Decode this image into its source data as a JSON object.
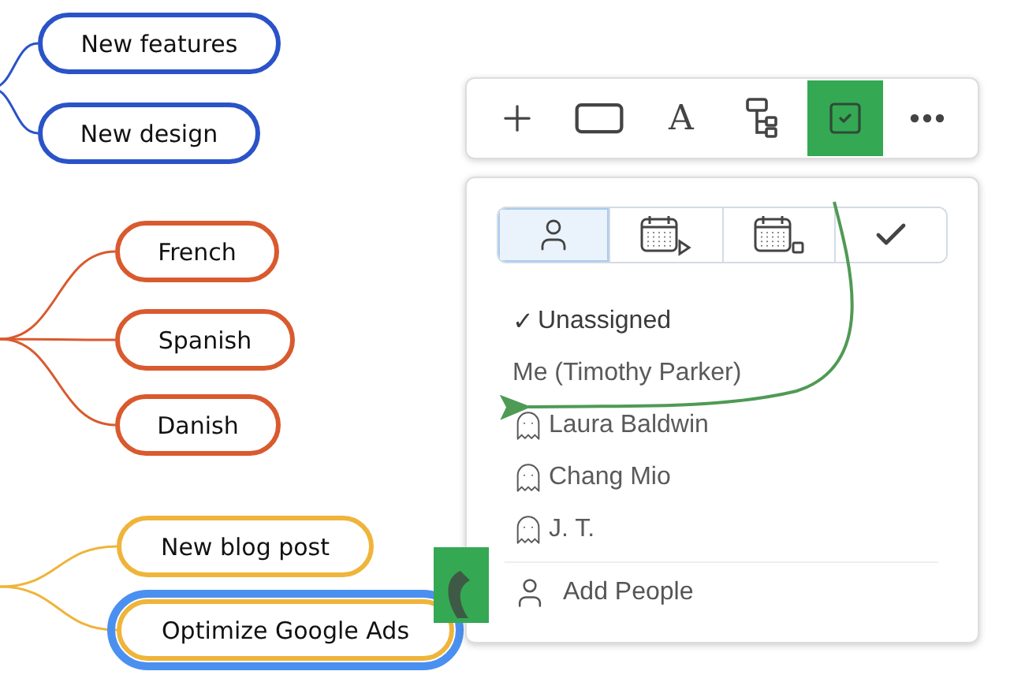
{
  "branches": [
    {
      "color": "#2b53c8",
      "nodes": [
        {
          "label": "New features",
          "selected": false
        },
        {
          "label": "New design",
          "selected": false
        }
      ]
    },
    {
      "color": "#d95a2e",
      "nodes": [
        {
          "label": "French",
          "selected": false
        },
        {
          "label": "Spanish",
          "selected": false
        },
        {
          "label": "Danish",
          "selected": false
        }
      ]
    },
    {
      "color": "#efb43a",
      "nodes": [
        {
          "label": "New blog post",
          "selected": false
        },
        {
          "label": "Optimize Google Ads",
          "selected": true
        }
      ]
    }
  ],
  "toolbar": {
    "tools": [
      {
        "kind": "add",
        "highlighted": false
      },
      {
        "kind": "shape",
        "highlighted": false
      },
      {
        "kind": "text",
        "glyph": "A",
        "highlighted": false
      },
      {
        "kind": "tree",
        "highlighted": false
      },
      {
        "kind": "task",
        "highlighted": true
      },
      {
        "kind": "more",
        "highlighted": false
      }
    ]
  },
  "assign_panel": {
    "tabs": [
      {
        "kind": "person",
        "selected": true
      },
      {
        "kind": "start-date",
        "selected": false
      },
      {
        "kind": "due-date",
        "selected": false
      },
      {
        "kind": "done",
        "selected": false
      }
    ],
    "check_mark": "✓",
    "options": [
      {
        "label": "Unassigned",
        "kind": "plain",
        "selected": true
      },
      {
        "label": "Me (Timothy Parker)",
        "kind": "plain",
        "selected": false
      },
      {
        "label": "Laura Baldwin",
        "kind": "placeholder",
        "selected": false
      },
      {
        "label": "Chang Mio",
        "kind": "placeholder",
        "selected": false
      },
      {
        "label": "J. T.",
        "kind": "placeholder",
        "selected": false
      }
    ],
    "add_people": "Add People"
  }
}
